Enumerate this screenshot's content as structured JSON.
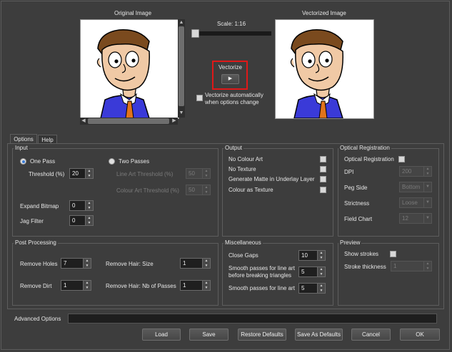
{
  "preview": {
    "original_title": "Original Image",
    "vectorized_title": "Vectorized Image",
    "scale_label": "Scale: 1:16",
    "vectorize_label": "Vectorize",
    "auto_vectorize_label": "Vectorize automatically when options change"
  },
  "tabs": [
    "Options",
    "Help"
  ],
  "input": {
    "title": "Input",
    "one_pass": "One Pass",
    "two_passes": "Two Passes",
    "threshold_label": "Threshold (%)",
    "threshold_value": "20",
    "line_art_threshold_label": "Line Art Threshold (%)",
    "line_art_threshold_value": "50",
    "colour_art_threshold_label": "Colour Art Threshold (%)",
    "colour_art_threshold_value": "50",
    "expand_bitmap_label": "Expand Bitmap",
    "expand_bitmap_value": "0",
    "jag_filter_label": "Jag Filter",
    "jag_filter_value": "0"
  },
  "output": {
    "title": "Output",
    "no_colour_art": "No Colour Art",
    "no_texture": "No Texture",
    "generate_matte": "Generate Matte in Underlay Layer",
    "colour_as_texture": "Colour as Texture"
  },
  "optical": {
    "title": "Optical Registration",
    "optical_registration": "Optical Registration",
    "dpi_label": "DPI",
    "dpi_value": "200",
    "peg_side_label": "Peg Side",
    "peg_side_value": "Bottom",
    "strictness_label": "Strictness",
    "strictness_value": "Loose",
    "field_chart_label": "Field Chart",
    "field_chart_value": "12"
  },
  "post": {
    "title": "Post Processing",
    "remove_holes_label": "Remove Holes",
    "remove_holes_value": "7",
    "remove_dirt_label": "Remove Dirt",
    "remove_dirt_value": "1",
    "remove_hair_size_label": "Remove Hair: Size",
    "remove_hair_size_value": "1",
    "remove_hair_passes_label": "Remove Hair: Nb of Passes",
    "remove_hair_passes_value": "1"
  },
  "misc": {
    "title": "Miscellaneous",
    "close_gaps_label": "Close Gaps",
    "close_gaps_value": "10",
    "smooth_before_label_1": "Smooth passes for line art",
    "smooth_before_label_2": "before breaking triangles",
    "smooth_before_value": "5",
    "smooth_line_art_label": "Smooth passes for line art",
    "smooth_line_art_value": "5"
  },
  "preview_group": {
    "title": "Preview",
    "show_strokes": "Show strokes",
    "stroke_thickness_label": "Stroke thickness",
    "stroke_thickness_value": "1"
  },
  "advanced_label": "Advanced Options",
  "buttons": {
    "load": "Load",
    "save": "Save",
    "restore": "Restore Defaults",
    "save_as_defaults": "Save As Defaults",
    "cancel": "Cancel",
    "ok": "OK"
  },
  "colors": {
    "background": "#3d3d3d",
    "highlight_box": "#e01818",
    "shirt": "#3a3ad8",
    "tie": "#e0741c"
  }
}
